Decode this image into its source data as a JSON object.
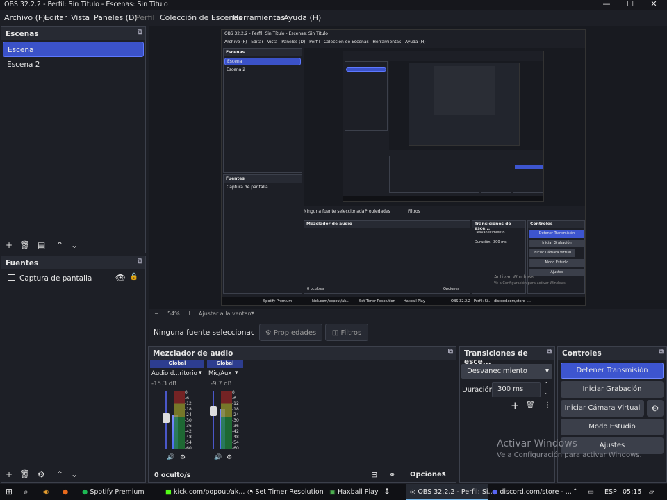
{
  "window": {
    "title": "OBS 32.2.2 - Perfil: Sin Título - Escenas: Sin Título"
  },
  "menu": [
    "Archivo (F)",
    "Editar",
    "Vista",
    "Paneles (D)",
    "Perfil",
    "Colección de Escenas",
    "Herramientas",
    "Ayuda (H)"
  ],
  "scenes": {
    "title": "Escenas",
    "items": [
      "Escena",
      "Escena 2"
    ]
  },
  "sources": {
    "title": "Fuentes",
    "items": [
      "Captura de pantalla"
    ]
  },
  "preview": {
    "inner_title": "OBS 32.2.2 - Perfil: Sin Título - Escenas: Sin Título",
    "inner_menu": "Archivo (F)   Editar   Vista   Paneles (D)   Perfil   Colección de Escenas   Herramientas   Ayuda (H)",
    "inner_no_source": "Ninguna fuente seleccionada",
    "inner_scene_items": [
      "Escena",
      "Escena 2"
    ],
    "inner_sources_title": "Fuentes",
    "inner_source_item": "Captura de pantalla",
    "inner_mixer_title": "Mezclador de audio",
    "inner_trans_title": "Transiciones de esce...",
    "inner_controls_title": "Controles",
    "inner_buttons": [
      "Detener Transmisión",
      "Iniciar Grabación",
      "Iniciar Cámara Virtual",
      "Modo Estudio",
      "Ajustes"
    ],
    "inner_trans_value": "Desvanecimiento",
    "inner_duration_label": "Duración",
    "inner_duration": "300 ms",
    "inner_taskbar": [
      "Spotify Premium",
      "kick.com/popout/ak...",
      "Set Timer Resolution",
      "Haxball Play",
      "OBS 32.2.2 - Perfil: Si...",
      "discord.com/store -..."
    ],
    "inner_activate": "Activar Windows",
    "inner_activate_sub": "Ve a Configuración para activar Windows.",
    "inner_props": "Propiedades",
    "inner_filters": "Filtros",
    "inner_options": "Opciones",
    "inner_hidden": "0 oculto/s",
    "inner_zoom": "54%",
    "inner_fit": "Ajustar a la ventana"
  },
  "zoom_bar": {
    "minus": "−",
    "zoom": "54%",
    "plus": "+",
    "fit": "Ajustar a la ventana"
  },
  "source_bar": {
    "no_source": "Ninguna fuente seleccionac",
    "properties": "Propiedades",
    "filters": "Filtros"
  },
  "mixer": {
    "title": "Mezclador de audio",
    "channels": [
      {
        "tag": "Global",
        "name": "Audio d...ritorio",
        "db": "-15.3 dB"
      },
      {
        "tag": "Global",
        "name": "Mic/Aux",
        "db": "-9.7 dB"
      }
    ],
    "scale": [
      "0",
      "-6",
      "-12",
      "-18",
      "-24",
      "-30",
      "-36",
      "-42",
      "-48",
      "-54",
      "-60"
    ],
    "hidden": "0 oculto/s",
    "options": "Opciones"
  },
  "transitions": {
    "title": "Transiciones de esce...",
    "value": "Desvanecimiento",
    "duration_label": "Duración",
    "duration": "300 ms"
  },
  "controls": {
    "title": "Controles",
    "stop_stream": "Detener Transmisión",
    "start_rec": "Iniciar Grabación",
    "start_vcam": "Iniciar Cámara Virtual",
    "studio": "Modo Estudio",
    "settings": "Ajustes"
  },
  "watermark": {
    "line1": "Activar Windows",
    "line2": "Ve a Configuración para activar Windows."
  },
  "taskbar": {
    "items": [
      "Spotify Premium",
      "kick.com/popout/ak...",
      "Set Timer Resolution",
      "Haxball Play",
      "OBS 32.2.2 - Perfil: Si...",
      "discord.com/store - ..."
    ],
    "lang": "ESP",
    "time": "05:15"
  },
  "colors": {
    "accent": "#3d55cf",
    "panel_bg": "#1d1f26",
    "header_bg": "#272a33"
  }
}
